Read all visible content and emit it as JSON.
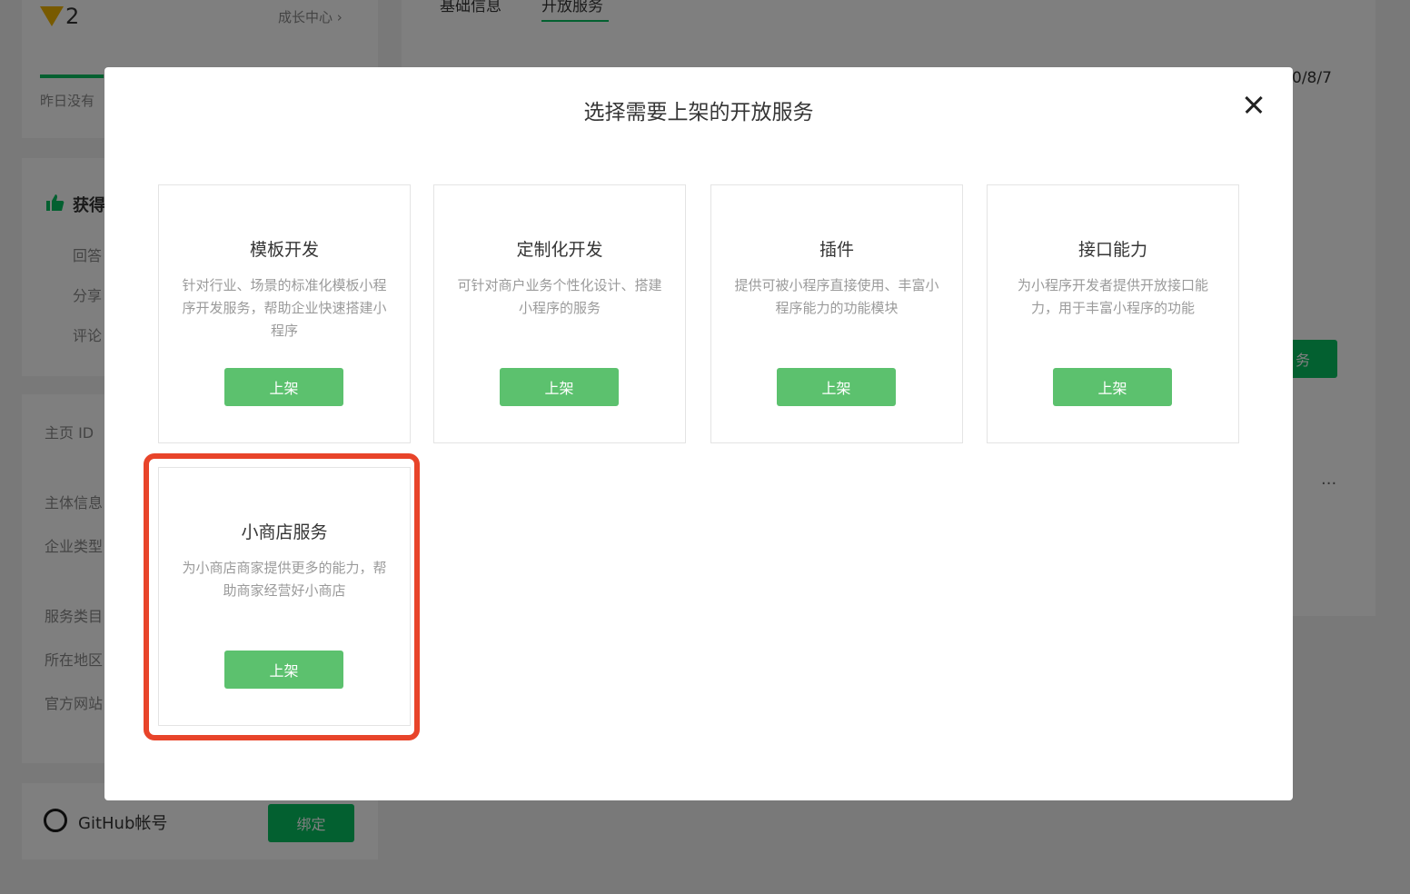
{
  "background": {
    "level": "2",
    "growth_center": "成长中心 ›",
    "progress": 0.2,
    "yesterday_text": "昨日没有",
    "earn_title": "获得",
    "earn_items": [
      "回答",
      "分享",
      "评论"
    ],
    "profile_labels": [
      "主页 ID",
      "主体信息",
      "企业类型",
      "服务类目",
      "所在地区",
      "官方网站"
    ],
    "github_label": "GitHub帐号",
    "bind_button": "绑定",
    "tabs": [
      "基础信息",
      "开放服务"
    ],
    "date_fragment": "0/8/7",
    "service_button_fragment": "务",
    "more_dots": "···",
    "accent_color": "#07c160"
  },
  "modal": {
    "title": "选择需要上架的开放服务",
    "cards": [
      {
        "title": "模板开发",
        "desc": "针对行业、场景的标准化模板小程序开发服务，帮助企业快速搭建小程序",
        "button": "上架"
      },
      {
        "title": "定制化开发",
        "desc": "可针对商户业务个性化设计、搭建小程序的服务",
        "button": "上架"
      },
      {
        "title": "插件",
        "desc": "提供可被小程序直接使用、丰富小程序能力的功能模块",
        "button": "上架"
      },
      {
        "title": "接口能力",
        "desc": "为小程序开发者提供开放接口能力，用于丰富小程序的功能",
        "button": "上架"
      },
      {
        "title": "小商店服务",
        "desc": "为小商店商家提供更多的能力，帮助商家经营好小商店",
        "button": "上架"
      }
    ],
    "highlight_color": "#e8442a"
  }
}
